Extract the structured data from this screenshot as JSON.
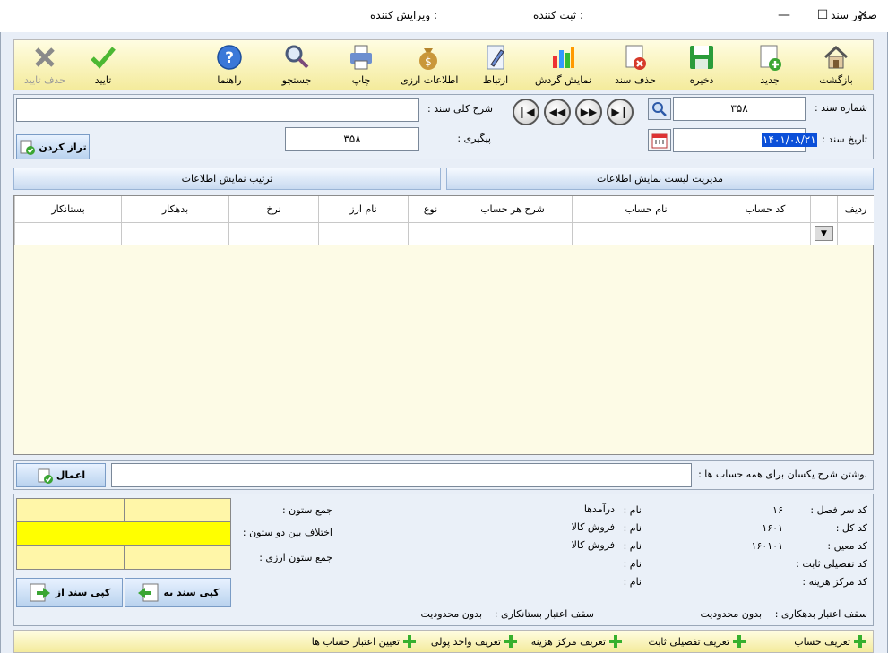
{
  "window": {
    "title": "صدور سند",
    "registrar_label": "ثبت کننده :",
    "editor_label": "ویرایش کننده :",
    "minimize": "—",
    "maximize": "☐",
    "close": "✕"
  },
  "toolbar": {
    "back": "بازگشت",
    "new": "جدید",
    "save": "ذخیره",
    "delete_doc": "حذف سند",
    "show_turnover": "نمایش گردش",
    "link": "ارتباط",
    "currency_info": "اطلاعات ارزی",
    "print": "چاپ",
    "search": "جستجو",
    "help": "راهنما",
    "approve": "تایید",
    "remove_approval": "حذف تایید"
  },
  "header": {
    "doc_number_label": "شماره سند :",
    "doc_number_value": "۳۵۸",
    "general_desc_label": "شرح کلی سند :",
    "general_desc_value": "",
    "doc_date_label": "تاریخ سند :",
    "doc_date_value": "۱۴۰۱/۰۸/۲۱",
    "followup_label": "پیگیری :",
    "followup_value": "۳۵۸",
    "balance_button": "تراز کردن"
  },
  "tabs": {
    "manage_list": "مدیریت لیست نمایش اطلاعات",
    "display_order": "ترتیب نمایش اطلاعات"
  },
  "grid": {
    "columns": [
      "ردیف",
      "کد حساب",
      "نام حساب",
      "شرح هر حساب",
      "نوع",
      "نام ارز",
      "نرخ",
      "بدهکار",
      "بستانکار"
    ]
  },
  "uniform_desc": {
    "label": "نوشتن شرح یکسان برای همه حساب ها :",
    "value": "",
    "apply_button": "اعمال"
  },
  "summary": {
    "column_sum_label": "جمع ستون :",
    "column_diff_label": "اختلاف بین دو ستون :",
    "currency_sum_label": "جمع ستون ارزی :",
    "copy_to_button": "کپی سند به",
    "copy_from_button": "کپی سند از"
  },
  "account_info": {
    "chapter_code_label": "کد سر فصل :",
    "chapter_code_value": "۱۶",
    "chapter_name_label": "نام :",
    "chapter_name_value": "درآمدها",
    "general_code_label": "کد کل :",
    "general_code_value": "۱۶۰۱",
    "general_name_label": "نام :",
    "general_name_value": "فروش کالا",
    "specific_code_label": "کد معین :",
    "specific_code_value": "۱۶۰۱۰۱",
    "specific_name_label": "نام :",
    "specific_name_value": "فروش کالا",
    "fixed_detail_label": "کد تفصیلی ثابت :",
    "fixed_detail_name_label": "نام :",
    "cost_center_label": "کد مرکز هزینه :",
    "cost_center_name_label": "نام :",
    "debit_limit_label": "سقف اعتبار بدهکاری :",
    "debit_limit_value": "بدون محدودیت",
    "credit_limit_label": "سقف اعتبار بستانکاری :",
    "credit_limit_value": "بدون محدودیت"
  },
  "footer": {
    "define_account": "تعریف حساب",
    "define_fixed_detail": "تعریف تفصیلی ثابت",
    "define_cost_center": "تعریف مرکز هزینه",
    "define_currency": "تعریف واحد پولی",
    "set_account_credit": "تعیین اعتبار حساب ها"
  },
  "colors": {
    "toolbar_bg": "#f4eb9c",
    "grid_bg": "#fdfbe6",
    "diff_highlight": "#ffff00",
    "sum_cell": "#fff6a8"
  }
}
